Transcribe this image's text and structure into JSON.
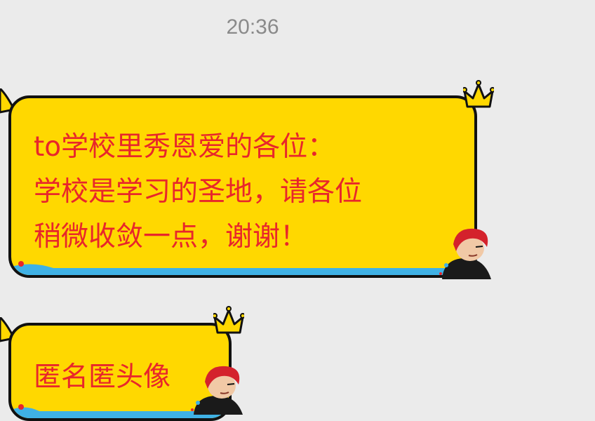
{
  "header": {
    "time": "20:36"
  },
  "messages": [
    {
      "lines": [
        "to学校里秀恩爱的各位：",
        "学校是学习的圣地，请各位",
        "稍微收敛一点，谢谢！"
      ]
    },
    {
      "lines": [
        "匿名匿头像"
      ]
    }
  ],
  "colors": {
    "background": "#ebebeb",
    "bubble_fill": "#ffd800",
    "bubble_border": "#111111",
    "text": "#e8262b",
    "wave": "#3fb1e5",
    "timestamp": "#8a8a8a"
  },
  "icons": [
    "crown-icon",
    "avatar-sticker-icon",
    "bubble-tail-icon"
  ]
}
